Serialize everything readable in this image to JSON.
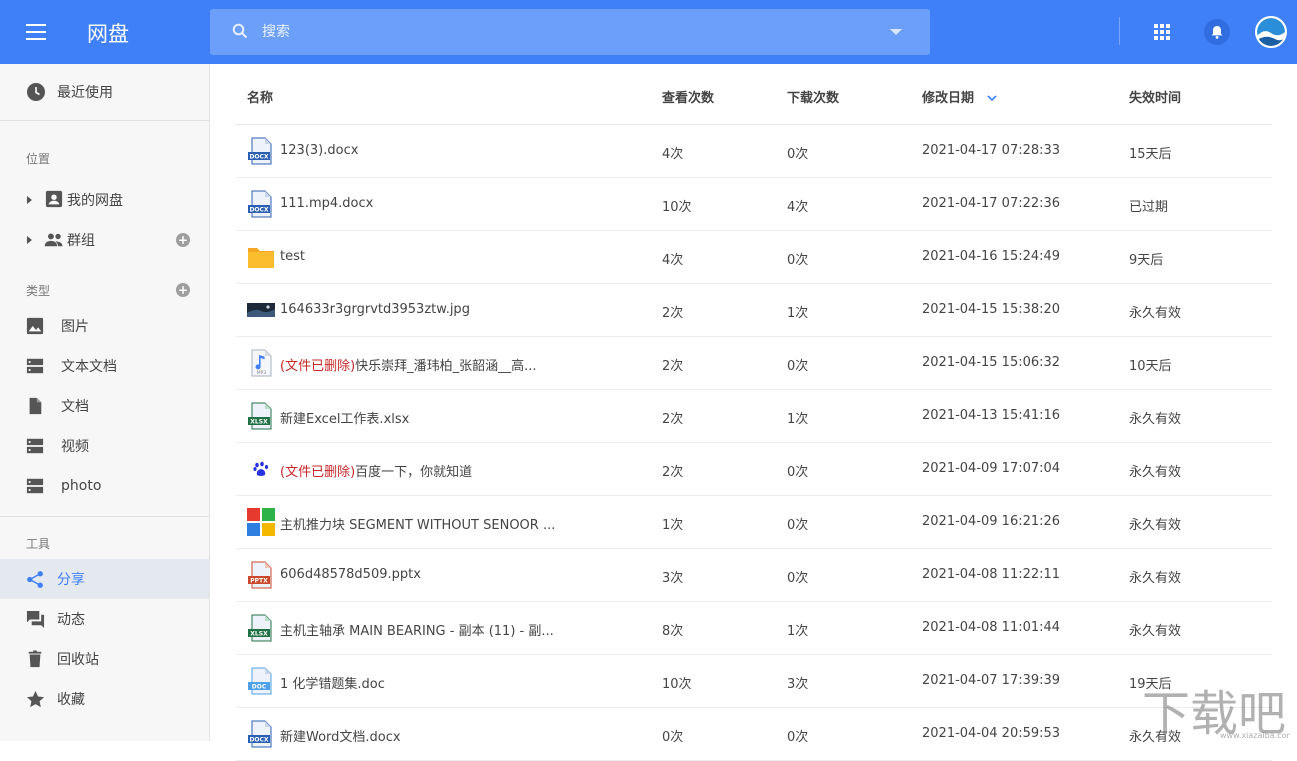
{
  "header": {
    "title": "网盘",
    "search_placeholder": "搜索"
  },
  "sidebar": {
    "recent": "最近使用",
    "section_location": "位置",
    "my_drive": "我的网盘",
    "groups": "群组",
    "section_types": "类型",
    "types": [
      "图片",
      "文本文档",
      "文档",
      "视频",
      "photo"
    ],
    "section_tools": "工具",
    "tools": [
      "分享",
      "动态",
      "回收站",
      "收藏"
    ]
  },
  "table": {
    "columns": {
      "name": "名称",
      "views": "查看次数",
      "downloads": "下载次数",
      "modified": "修改日期",
      "expires": "失效时间"
    },
    "rows": [
      {
        "icon": "docx-file-icon",
        "prefix": "",
        "name": "123(3).docx",
        "views": "4次",
        "downloads": "0次",
        "modified": "2021-04-17 07:28:33",
        "expires": "15天后"
      },
      {
        "icon": "docx-file-icon",
        "prefix": "",
        "name": "111.mp4.docx",
        "views": "10次",
        "downloads": "4次",
        "modified": "2021-04-17 07:22:36",
        "expires": "已过期"
      },
      {
        "icon": "folder-icon",
        "prefix": "",
        "name": "test",
        "views": "4次",
        "downloads": "0次",
        "modified": "2021-04-16 15:24:49",
        "expires": "9天后"
      },
      {
        "icon": "image-thumbnail-icon",
        "prefix": "",
        "name": "164633r3grgrvtd3953ztw.jpg",
        "views": "2次",
        "downloads": "1次",
        "modified": "2021-04-15 15:38:20",
        "expires": "永久有效"
      },
      {
        "icon": "mp3-file-icon",
        "prefix": "(文件已删除)",
        "name": "快乐崇拜_潘玮柏_张韶涵__高...",
        "views": "2次",
        "downloads": "0次",
        "modified": "2021-04-15 15:06:32",
        "expires": "10天后"
      },
      {
        "icon": "xlsx-file-icon",
        "prefix": "",
        "name": "新建Excel工作表.xlsx",
        "views": "2次",
        "downloads": "1次",
        "modified": "2021-04-13 15:41:16",
        "expires": "永久有效"
      },
      {
        "icon": "baidu-paw-icon",
        "prefix": "(文件已删除)",
        "name": "百度一下，你就知道",
        "views": "2次",
        "downloads": "0次",
        "modified": "2021-04-09 17:07:04",
        "expires": "永久有效"
      },
      {
        "icon": "colored-tiles-icon",
        "prefix": "",
        "name": "主机推力块 SEGMENT WITHOUT SENOOR ...",
        "views": "1次",
        "downloads": "0次",
        "modified": "2021-04-09 16:21:26",
        "expires": "永久有效"
      },
      {
        "icon": "pptx-file-icon",
        "prefix": "",
        "name": "606d48578d509.pptx",
        "views": "3次",
        "downloads": "0次",
        "modified": "2021-04-08 11:22:11",
        "expires": "永久有效"
      },
      {
        "icon": "xlsx-file-icon",
        "prefix": "",
        "name": "主机主轴承 MAIN BEARING - 副本 (11) - 副...",
        "views": "8次",
        "downloads": "1次",
        "modified": "2021-04-08 11:01:44",
        "expires": "永久有效"
      },
      {
        "icon": "doc-file-icon",
        "prefix": "",
        "name": "1 化学错题集.doc",
        "views": "10次",
        "downloads": "3次",
        "modified": "2021-04-07 17:39:39",
        "expires": "19天后"
      },
      {
        "icon": "docx-file-icon",
        "prefix": "",
        "name": "新建Word文档.docx",
        "views": "0次",
        "downloads": "0次",
        "modified": "2021-04-04 20:59:53",
        "expires": "永久有效"
      }
    ]
  },
  "icon_labels": {
    "docx": "DOCX",
    "doc": "DOC",
    "xlsx": "XLSX",
    "pptx": "PPTX",
    "mp3": "MP3"
  },
  "watermark": {
    "text": "下载吧",
    "url": "www.xiazaiba.com"
  },
  "colors": {
    "header_bg": "#3f80f8",
    "search_bg": "#6b9ffa",
    "active_accent": "#3f80f8",
    "deleted_text": "#c62828"
  }
}
